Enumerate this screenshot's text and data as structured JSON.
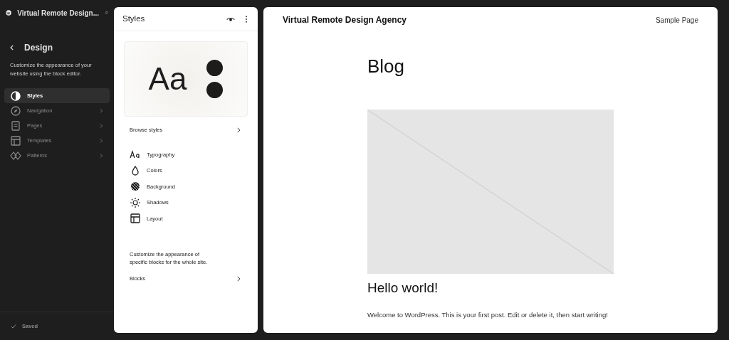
{
  "sidebar": {
    "site_title": "Virtual Remote Design...",
    "section_title": "Design",
    "description": "Customize the appearance of your website using the block editor.",
    "items": [
      {
        "label": "Styles",
        "selected": true,
        "has_chevron": false
      },
      {
        "label": "Navigation",
        "selected": false,
        "has_chevron": true
      },
      {
        "label": "Pages",
        "selected": false,
        "has_chevron": true
      },
      {
        "label": "Templates",
        "selected": false,
        "has_chevron": true
      },
      {
        "label": "Patterns",
        "selected": false,
        "has_chevron": true
      }
    ],
    "status": "Saved"
  },
  "styles_panel": {
    "title": "Styles",
    "preview_text": "Aa",
    "browse": "Browse styles",
    "items": [
      {
        "label": "Typography",
        "kind": "typography"
      },
      {
        "label": "Colors",
        "kind": "colors"
      },
      {
        "label": "Background",
        "kind": "background"
      },
      {
        "label": "Shadows",
        "kind": "shadows"
      },
      {
        "label": "Layout",
        "kind": "layout"
      }
    ],
    "blocks_description": "Customize the appearance of specific blocks for the whole site.",
    "blocks": "Blocks"
  },
  "preview": {
    "site_title": "Virtual Remote Design Agency",
    "nav_link": "Sample Page",
    "page_title": "Blog",
    "post_title": "Hello world!",
    "post_excerpt": "Welcome to WordPress. This is your first post. Edit or delete it, then start writing!"
  }
}
